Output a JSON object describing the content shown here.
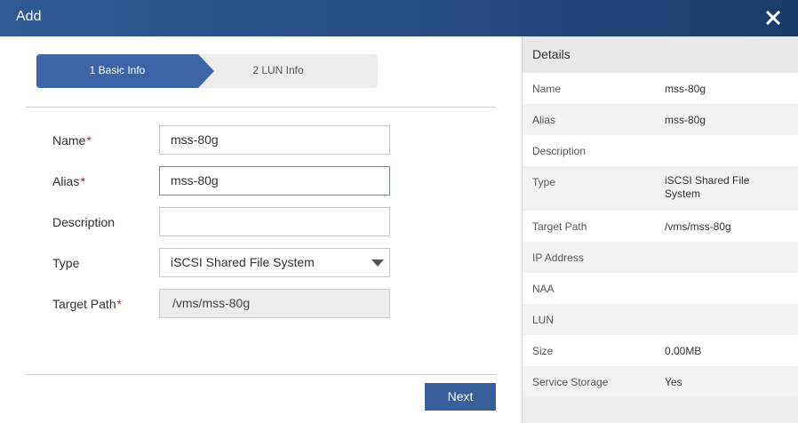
{
  "dialog": {
    "title": "Add"
  },
  "steps": [
    {
      "label": "1 Basic Info",
      "active": true
    },
    {
      "label": "2 LUN Info",
      "active": false
    }
  ],
  "form": {
    "name": {
      "label": "Name",
      "required": "*",
      "value": "mss-80g"
    },
    "alias": {
      "label": "Alias",
      "required": "*",
      "value": "mss-80g"
    },
    "description": {
      "label": "Description",
      "value": ""
    },
    "type": {
      "label": "Type",
      "value": "iSCSI Shared File System"
    },
    "target_path": {
      "label": "Target Path",
      "required": "*",
      "value": "/vms/mss-80g"
    }
  },
  "buttons": {
    "next": "Next"
  },
  "details": {
    "title": "Details",
    "rows": [
      {
        "key": "Name",
        "value": "mss-80g"
      },
      {
        "key": "Alias",
        "value": "mss-80g"
      },
      {
        "key": "Description",
        "value": ""
      },
      {
        "key": "Type",
        "value": "iSCSI Shared File System"
      },
      {
        "key": "Target Path",
        "value": "/vms/mss-80g"
      },
      {
        "key": "IP Address",
        "value": ""
      },
      {
        "key": "NAA",
        "value": ""
      },
      {
        "key": "LUN",
        "value": ""
      },
      {
        "key": "Size",
        "value": "0.00MB"
      },
      {
        "key": "Service Storage",
        "value": "Yes"
      }
    ]
  },
  "icons": {
    "close": "close-icon",
    "dropdown": "chevron-down-icon"
  },
  "colors": {
    "header": "#2f5a96",
    "accent": "#3b65a8",
    "required": "#d9262c"
  }
}
